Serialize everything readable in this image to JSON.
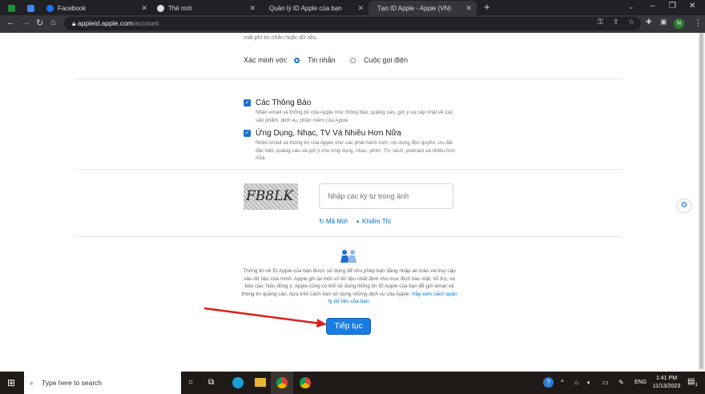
{
  "browser": {
    "tabs": [
      {
        "label": "Facebook"
      },
      {
        "label": "Thẻ mới"
      },
      {
        "label": "Quản lý ID Apple của bạn"
      },
      {
        "label": "Tạo ID Apple - Apple (VN)",
        "active": true
      }
    ],
    "url_host": "appleid.apple.com",
    "url_path": "/account",
    "profile_initial": "N"
  },
  "page": {
    "top_text": "mất phí tin nhắn hoặc dữ liệu.",
    "verify_label": "Xác minh với:",
    "verify_options": [
      {
        "label": "Tin nhắn",
        "selected": true
      },
      {
        "label": "Cuộc gọi điện",
        "selected": false
      }
    ],
    "subscriptions": [
      {
        "title": "Các Thông Báo",
        "desc": "Nhận email và thông tin của Apple như thông báo, quảng cáo, gợi ý và cập nhật về các sản phẩm, dịch vụ, phần mềm của Apple.",
        "checked": true
      },
      {
        "title": "Ứng Dụng, Nhạc, TV Và Nhiều Hơn Nữa",
        "desc": "Nhận email và thông tin của Apple như các phát hành mới, nội dung độc quyền, ưu đãi đặc biệt, quảng cáo và gợi ý cho ứng dụng, nhạc, phim, TV, sách, podcast và nhiều hơn nữa.",
        "checked": true
      }
    ],
    "captcha_text": "FB8LK",
    "captcha_placeholder": "Nhập các ký tự trong ảnh",
    "new_code": "Mã Mới",
    "audio": "Khiếm Thị",
    "privacy_text": "Thông tin về ID Apple của bạn được sử dụng để cho phép bạn đăng nhập an toàn và truy cập vào dữ liệu của mình. Apple ghi lại một số dữ liệu nhất định cho mục đích bảo mật, hỗ trợ, và báo cáo. Nếu đồng ý, Apple cũng có thể sử dụng thông tin ID Apple của bạn để gửi email và thông tin quảng cáo, dựa trên cách bạn sử dụng những dịch vụ của Apple.",
    "privacy_link": "Hãy xem cách quản lý dữ liệu của bạn.",
    "continue": "Tiếp tục"
  },
  "taskbar": {
    "search_placeholder": "Type here to search",
    "lang": "ENG",
    "time": "1:41 PM",
    "date": "11/13/2023",
    "notif_count": "1"
  }
}
